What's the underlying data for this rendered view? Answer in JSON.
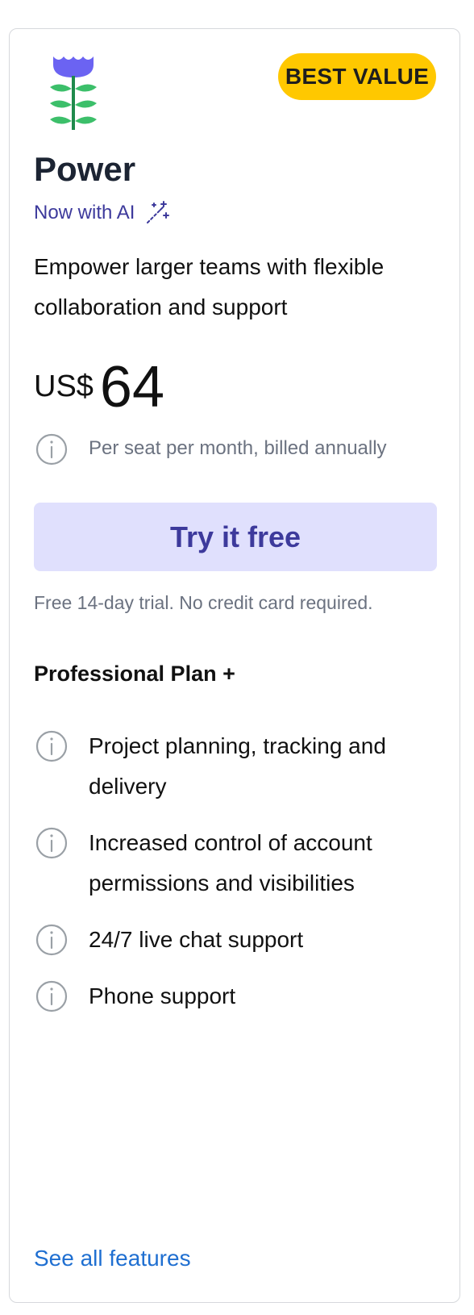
{
  "plan": {
    "badge": "BEST VALUE",
    "name": "Power",
    "ai_label": "Now with AI",
    "description": "Empower larger teams with flexible collaboration and support",
    "currency": "US$",
    "price": "64",
    "billing_note": "Per seat per month, billed annually",
    "cta_label": "Try it free",
    "trial_note": "Free 14-day trial. No credit card required.",
    "features_heading": "Professional Plan +",
    "features": [
      {
        "label": "Project planning, tracking and delivery"
      },
      {
        "label": "Increased control of account permissions and visibilities"
      },
      {
        "label": "24/7 live chat support"
      },
      {
        "label": "Phone support"
      }
    ],
    "see_all_link": "See all features"
  },
  "colors": {
    "badge": "#ffc800",
    "accent": "#3d3a9c",
    "cta_bg": "#e0e0fd",
    "link": "#1f6fd1",
    "muted": "#6b7280",
    "flower_petals": "#6b63f2",
    "leaves": "#3cbf6a",
    "stem": "#1f8a4c"
  },
  "icons": {
    "logo": "flower-icon",
    "ai": "magic-wand-icon",
    "info": "info-icon"
  }
}
